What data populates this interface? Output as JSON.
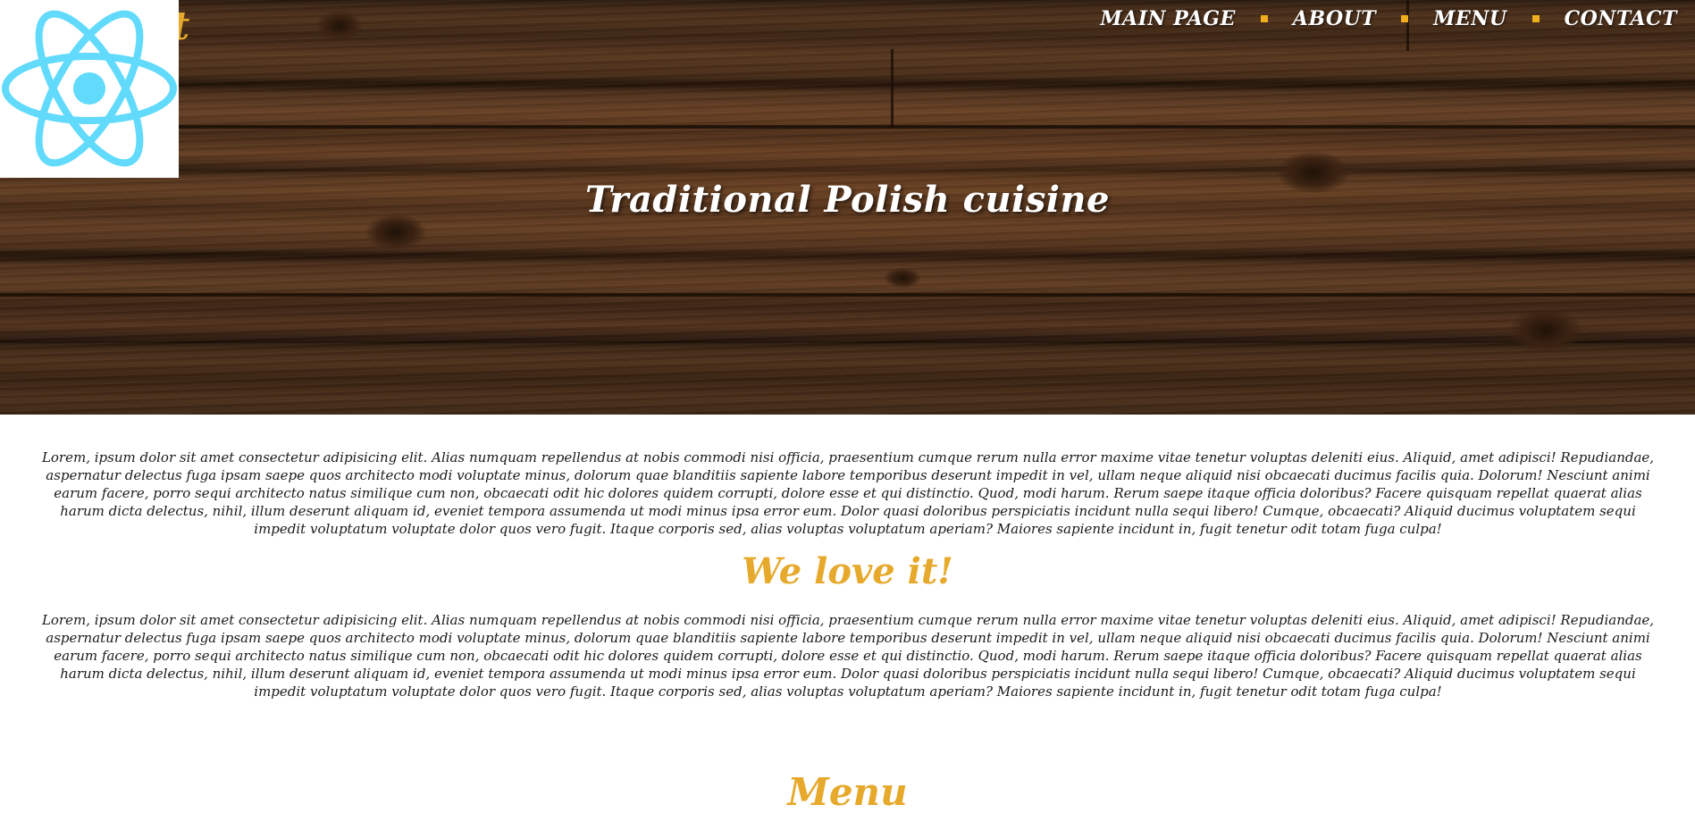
{
  "brand": {
    "text": "nt",
    "logo_icon": "react-atom-icon",
    "logo_color": "#61dafb"
  },
  "nav": {
    "items": [
      {
        "label": "MAIN PAGE"
      },
      {
        "label": "ABOUT"
      },
      {
        "label": "MENU"
      },
      {
        "label": "CONTACT"
      }
    ],
    "separator_color": "#f0ad1e"
  },
  "hero": {
    "title": "Traditional Polish cuisine"
  },
  "content": {
    "paragraph_1": "Lorem, ipsum dolor sit amet consectetur adipisicing elit. Alias numquam repellendus at nobis commodi nisi officia, praesentium cumque rerum nulla error maxime vitae tenetur voluptas deleniti eius. Aliquid, amet adipisci! Repudiandae, aspernatur delectus fuga ipsam saepe quos architecto modi voluptate minus, dolorum quae blanditiis sapiente labore temporibus deserunt impedit in vel, ullam neque aliquid nisi obcaecati ducimus facilis quia. Dolorum! Nesciunt animi earum facere, porro sequi architecto natus similique cum non, obcaecati odit hic dolores quidem corrupti, dolore esse et qui distinctio. Quod, modi harum. Rerum saepe itaque officia doloribus? Facere quisquam repellat quaerat alias harum dicta delectus, nihil, illum deserunt aliquam id, eveniet tempora assumenda ut modi minus ipsa error eum. Dolor quasi doloribus perspiciatis incidunt nulla sequi libero! Cumque, obcaecati? Aliquid ducimus voluptatem sequi impedit voluptatum voluptate dolor quos vero fugit. Itaque corporis sed, alias voluptas voluptatum aperiam? Maiores sapiente incidunt in, fugit tenetur odit totam fuga culpa!",
    "heading_love": "We love it!",
    "paragraph_2": "Lorem, ipsum dolor sit amet consectetur adipisicing elit. Alias numquam repellendus at nobis commodi nisi officia, praesentium cumque rerum nulla error maxime vitae tenetur voluptas deleniti eius. Aliquid, amet adipisci! Repudiandae, aspernatur delectus fuga ipsam saepe quos architecto modi voluptate minus, dolorum quae blanditiis sapiente labore temporibus deserunt impedit in vel, ullam neque aliquid nisi obcaecati ducimus facilis quia. Dolorum! Nesciunt animi earum facere, porro sequi architecto natus similique cum non, obcaecati odit hic dolores quidem corrupti, dolore esse et qui distinctio. Quod, modi harum. Rerum saepe itaque officia doloribus? Facere quisquam repellat quaerat alias harum dicta delectus, nihil, illum deserunt aliquam id, eveniet tempora assumenda ut modi minus ipsa error eum. Dolor quasi doloribus perspiciatis incidunt nulla sequi libero! Cumque, obcaecati? Aliquid ducimus voluptatem sequi impedit voluptatum voluptate dolor quos vero fugit. Itaque corporis sed, alias voluptas voluptatum aperiam? Maiores sapiente incidunt in, fugit tenetur odit totam fuga culpa!",
    "heading_menu": "Menu"
  },
  "colors": {
    "accent": "#e6a92c",
    "text": "#1a1a1a",
    "hero_text": "#ffffff"
  }
}
